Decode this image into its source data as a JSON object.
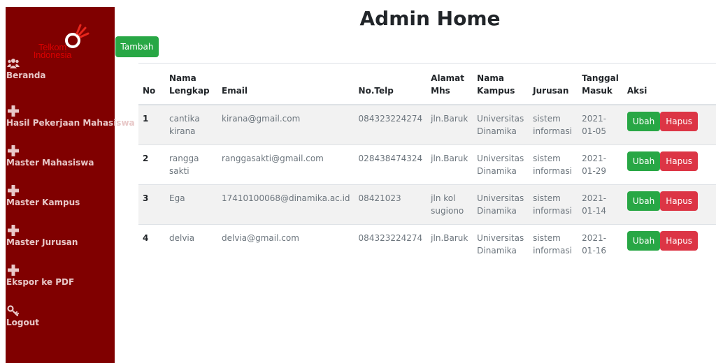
{
  "sidebar": {
    "logo": {
      "line1": "Telkom",
      "line2": "Indonesia"
    },
    "items": [
      {
        "label": "Beranda",
        "icon": "users-icon"
      },
      {
        "label": "Hasil Pekerjaan Mahasiswa",
        "icon": "plus-icon"
      },
      {
        "label": "Master Mahasiswa",
        "icon": "plus-icon"
      },
      {
        "label": "Master Kampus",
        "icon": "plus-icon"
      },
      {
        "label": "Master Jurusan",
        "icon": "plus-icon"
      },
      {
        "label": "Ekspor ke PDF",
        "icon": "plus-icon"
      },
      {
        "label": "Logout",
        "icon": "key-icon"
      }
    ]
  },
  "header": {
    "title": "Admin Home"
  },
  "toolbar": {
    "add_label": "Tambah"
  },
  "table": {
    "headers": [
      "No",
      "Nama Lengkap",
      "Email",
      "No.Telp",
      "Alamat Mhs",
      "Nama Kampus",
      "Jurusan",
      "Tanggal Masuk",
      "Aksi"
    ],
    "edit_label": "Ubah",
    "delete_label": "Hapus",
    "rows": [
      {
        "no": "1",
        "nama": "cantika kirana",
        "email": "kirana@gmail.com",
        "telp": "084323224274",
        "alamat": "jln.Baruk",
        "kampus": "Universitas Dinamika",
        "jurusan": "sistem informasi",
        "tanggal": "2021-01-05"
      },
      {
        "no": "2",
        "nama": "rangga sakti",
        "email": "ranggasakti@gmail.com",
        "telp": "028438474324",
        "alamat": "jln.Baruk",
        "kampus": "Universitas Dinamika",
        "jurusan": "sistem informasi",
        "tanggal": "2021-01-29"
      },
      {
        "no": "3",
        "nama": "Ega",
        "email": "17410100068@dinamika.ac.id",
        "telp": "08421023",
        "alamat": "jln kol sugiono",
        "kampus": "Universitas Dinamika",
        "jurusan": "sistem informasi",
        "tanggal": "2021-01-14"
      },
      {
        "no": "4",
        "nama": "delvia",
        "email": "delvia@gmail.com",
        "telp": "084323224274",
        "alamat": "jln.Baruk",
        "kampus": "Universitas Dinamika",
        "jurusan": "sistem informasi",
        "tanggal": "2021-01-16"
      }
    ]
  },
  "colors": {
    "sidebar": "#800000",
    "success": "#28a745",
    "danger": "#dc3545"
  }
}
